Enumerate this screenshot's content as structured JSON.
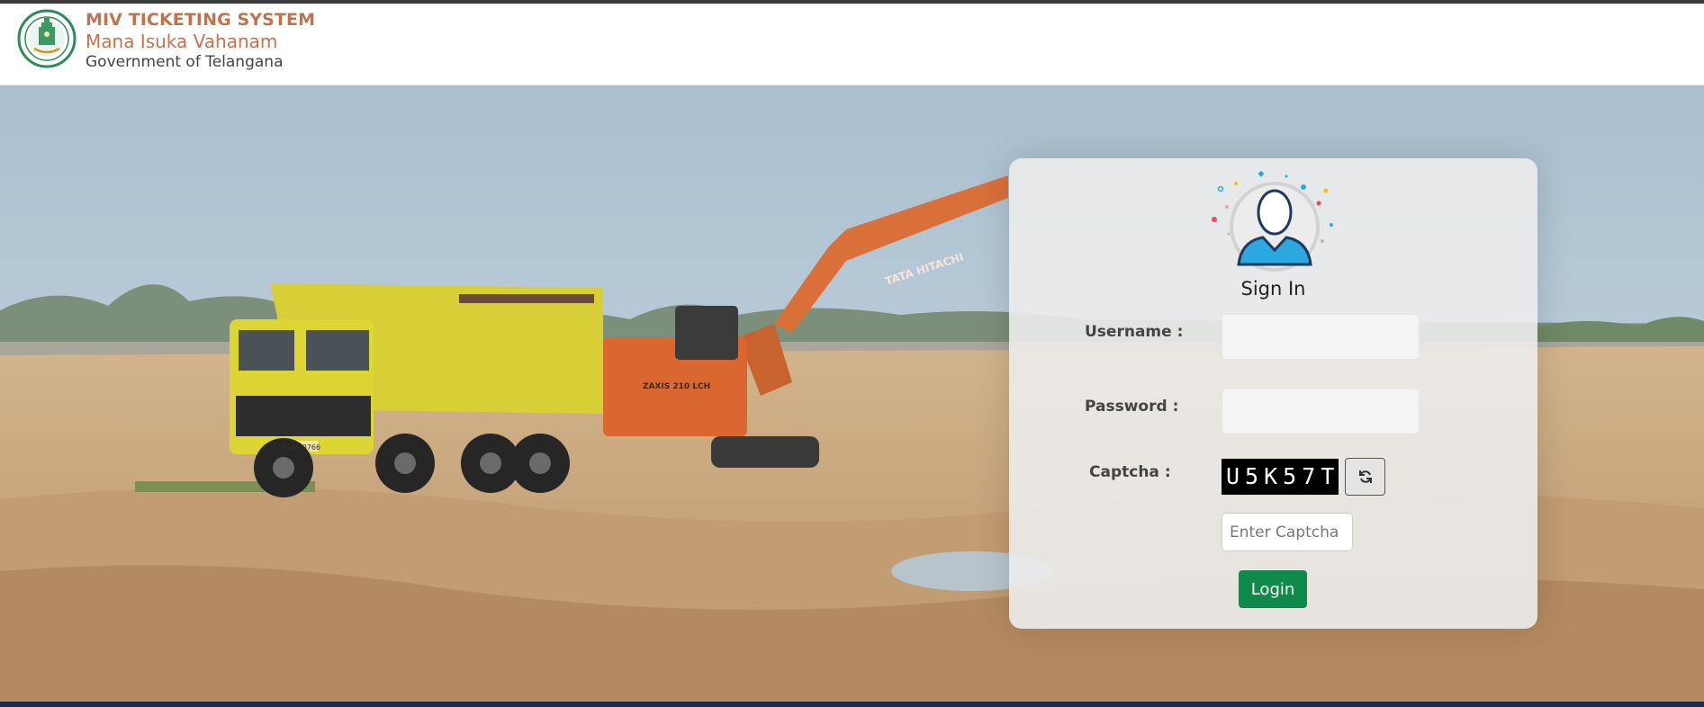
{
  "header": {
    "title": "MIV TICKETING SYSTEM",
    "subtitle": "Mana Isuka Vahanam",
    "government": "Government of Telangana"
  },
  "hero": {
    "truck_plate": "TS06 0766",
    "excavator_brand": "TATA HITACHI",
    "excavator_model": "ZAXIS 210 LCH"
  },
  "login": {
    "title": "Sign In",
    "username_label": "Username :",
    "password_label": "Password :",
    "captcha_label": "Captcha :",
    "captcha_code": "U5K57T",
    "captcha_placeholder": "Enter Captcha",
    "login_button": "Login"
  },
  "colors": {
    "brand": "#c0734f",
    "login_button": "#0f8a4b",
    "footer_bar": "#1f2a4a"
  },
  "icons": {
    "logo": "telangana-emblem-icon",
    "avatar": "user-avatar-icon",
    "refresh": "refresh-icon"
  }
}
